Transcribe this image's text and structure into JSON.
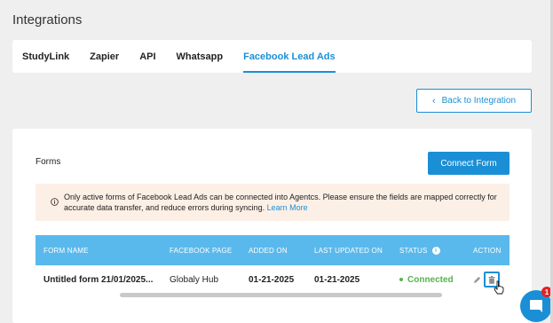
{
  "page": {
    "title": "Integrations"
  },
  "tabs": [
    {
      "label": "StudyLink",
      "active": false
    },
    {
      "label": "Zapier",
      "active": false
    },
    {
      "label": "API",
      "active": false
    },
    {
      "label": "Whatsapp",
      "active": false
    },
    {
      "label": "Facebook Lead Ads",
      "active": true
    }
  ],
  "back_button": {
    "label": "Back to Integration",
    "icon": "chevron-left-icon"
  },
  "forms": {
    "title": "Forms",
    "connect_label": "Connect Form",
    "notice": {
      "text": "Only active forms of Facebook Lead Ads can be connected into Agentcs. Please ensure the fields are mapped correctly for accurate data transfer, and reduce errors during syncing.",
      "link": "Learn More",
      "icon": "info-icon"
    },
    "table": {
      "headers": [
        "FORM NAME",
        "FACEBOOK PAGE",
        "ADDED ON",
        "LAST UPDATED ON",
        "STATUS",
        "ACTION"
      ],
      "rows": [
        {
          "form_name": "Untitled form 21/01/2025...",
          "facebook_page": "Globaly Hub",
          "added_on": "01-21-2025",
          "last_updated_on": "01-21-2025",
          "status": "Connected"
        }
      ]
    }
  },
  "chat": {
    "badge": "1",
    "icon": "chat-icon"
  },
  "colors": {
    "accent": "#1a8fd6",
    "header": "#5ab9ec",
    "connected": "#56b34e",
    "notice_bg": "#fcefe6",
    "badge": "#e02424"
  }
}
